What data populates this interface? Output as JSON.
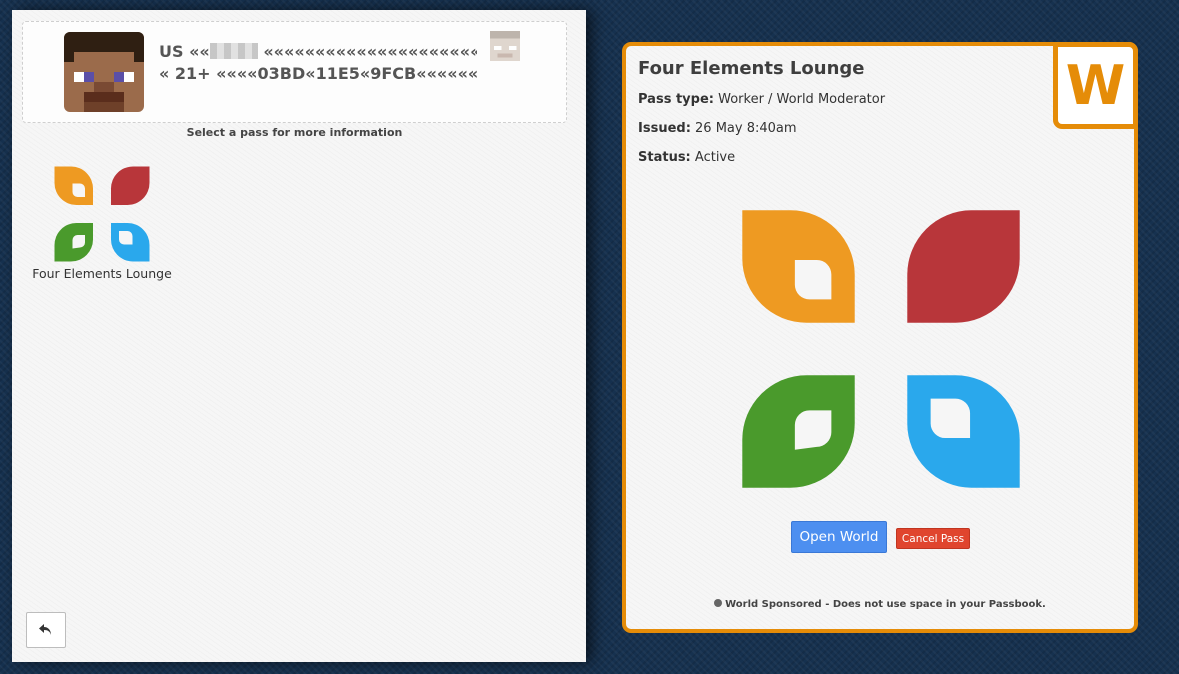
{
  "passport": {
    "line1_prefix": "US ««",
    "line1_suffix": "«««««««««««««««««««««",
    "line2": "« 21+ ««««03BD«11E5«9FCB««««««"
  },
  "helper_text": "Select a pass for more information",
  "passes": [
    {
      "label": "Four Elements Lounge"
    }
  ],
  "detail": {
    "title": "Four Elements Lounge",
    "pass_type_label": "Pass type:",
    "pass_type_value": "Worker / World Moderator",
    "issued_label": "Issued:",
    "issued_value": "26 May 8:40am",
    "status_label": "Status:",
    "status_value": "Active",
    "badge_letter": "W",
    "open_world_label": "Open World",
    "cancel_pass_label": "Cancel Pass",
    "footer_note": "World Sponsored - Does not use space in your Passbook."
  },
  "colors": {
    "accent": "#e58c08",
    "leaf_orange": "#ee9a22",
    "leaf_red": "#b8363a",
    "leaf_green": "#4a9a2c",
    "leaf_blue": "#2aa8ec",
    "open_world_button": "#4d8ff0",
    "cancel_pass_button": "#e0452e"
  },
  "icons": [
    "avatar-icon",
    "undo-arrow-icon",
    "globe-icon",
    "four-leaf-logo"
  ]
}
